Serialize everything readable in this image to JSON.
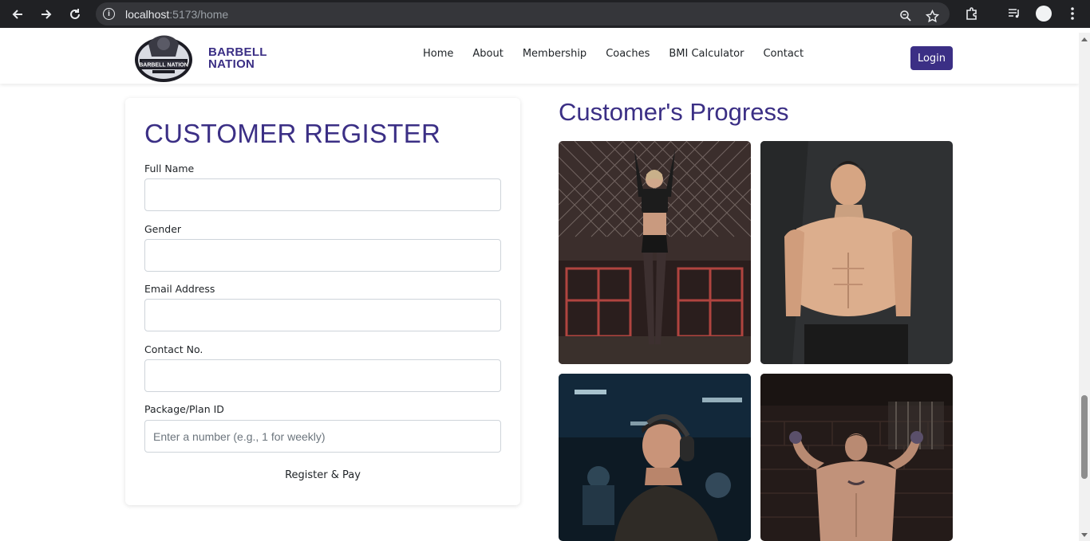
{
  "browser": {
    "url_host": "localhost",
    "url_rest": ":5173/home",
    "icons": [
      "back-arrow-icon",
      "forward-arrow-icon",
      "reload-icon",
      "info-icon",
      "zoom-icon",
      "star-icon",
      "extensions-icon",
      "media-icon",
      "profile-avatar",
      "menu-dots-icon"
    ]
  },
  "navbar": {
    "brand_line1": "BARBELL",
    "brand_line2": "NATION",
    "logo_text": "BARBELL NATION",
    "menu": [
      "Home",
      "About",
      "Membership",
      "Coaches",
      "BMI Calculator",
      "Contact"
    ],
    "login_label": "Login"
  },
  "register": {
    "title": "CUSTOMER REGISTER",
    "fields": [
      {
        "label": "Full Name",
        "value": "",
        "placeholder": ""
      },
      {
        "label": "Gender",
        "value": "",
        "placeholder": ""
      },
      {
        "label": "Email Address",
        "value": "",
        "placeholder": ""
      },
      {
        "label": "Contact No.",
        "value": "",
        "placeholder": ""
      },
      {
        "label": "Package/Plan ID",
        "value": "",
        "placeholder": "Enter a number (e.g., 1 for weekly)"
      }
    ],
    "submit_label": "Register & Pay"
  },
  "progress": {
    "title": "Customer's Progress"
  },
  "colors": {
    "brand": "#3b2f85",
    "chrome": "#202124"
  }
}
